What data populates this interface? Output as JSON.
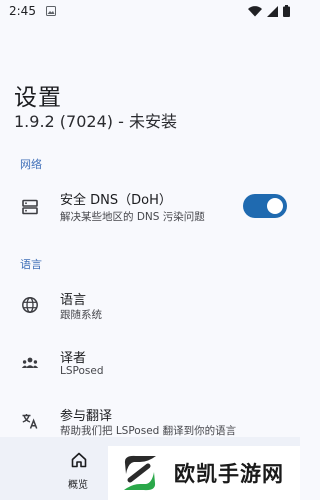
{
  "status_bar": {
    "time": "2:45"
  },
  "header": {
    "title": "设置",
    "version": "1.9.2 (7024) - 未安装"
  },
  "sections": [
    {
      "header": "网络",
      "items": [
        {
          "title": "安全 DNS（DoH）",
          "summary": "解决某些地区的 DNS 污染问题",
          "icon": "dns-icon",
          "toggle_on": true
        }
      ]
    },
    {
      "header": "语言",
      "items": [
        {
          "title": "语言",
          "summary": "跟随系统",
          "icon": "globe-icon"
        },
        {
          "title": "译者",
          "summary": "LSPosed",
          "icon": "people-icon"
        },
        {
          "title": "参与翻译",
          "summary": "帮助我们把 LSPosed 翻译到你的语言",
          "icon": "translate-icon"
        }
      ]
    }
  ],
  "bottom_nav": {
    "items": [
      {
        "label": "概览",
        "icon": "home-icon"
      }
    ]
  },
  "watermark": {
    "text": "欧凯手游网"
  },
  "colors": {
    "accent": "#1f6ab0",
    "section_header": "#3f6fb8",
    "background": "#f8f9fd",
    "nav_background": "#eef1f8"
  }
}
